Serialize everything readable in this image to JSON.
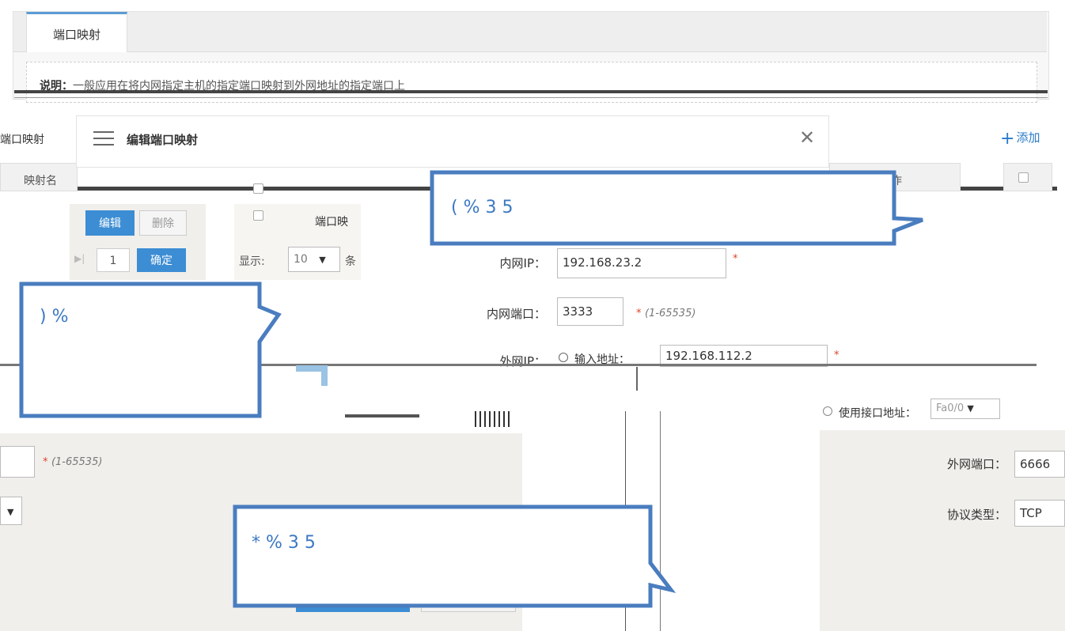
{
  "tab": {
    "label": "端口映射"
  },
  "description": {
    "prefix": "说明：",
    "text": "一般应用在将内网指定主机的指定端口映射到外网地址的指定端口上"
  },
  "list": {
    "title": "端口映射",
    "add_label": "添加",
    "col_name": "映射名",
    "col_action": "操作"
  },
  "toolbar": {
    "edit": "编辑",
    "delete": "删除"
  },
  "pager": {
    "page": "1",
    "confirm": "确定",
    "show": "显示:",
    "per_page": "10",
    "unit": "条"
  },
  "modal": {
    "title": "编辑端口映射",
    "inner_list_label": "端口映",
    "fields": {
      "inner_ip": {
        "label": "内网IP：",
        "value": "192.168.23.2"
      },
      "inner_port": {
        "label": "内网端口：",
        "value": "3333",
        "hint": "(1-65535)"
      },
      "outer_ip": {
        "label": "外网IP：",
        "option_input": "输入地址：",
        "value": "192.168.112.2",
        "option_iface": "使用接口地址：",
        "iface_value": "Fa0/0"
      },
      "outer_port": {
        "label": "外网端口：",
        "value": "6666",
        "hint": "(1-65535)"
      },
      "protocol": {
        "label": "协议类型：",
        "value": "TCP"
      }
    }
  },
  "callouts": [
    {
      "text": "( %                              3          5"
    },
    {
      "text": ") %"
    },
    {
      "text": "* %          3                    5"
    }
  ],
  "colors": {
    "accent": "#3c8dd4",
    "callout_border": "#4a7dbf",
    "required": "#e0422b"
  }
}
